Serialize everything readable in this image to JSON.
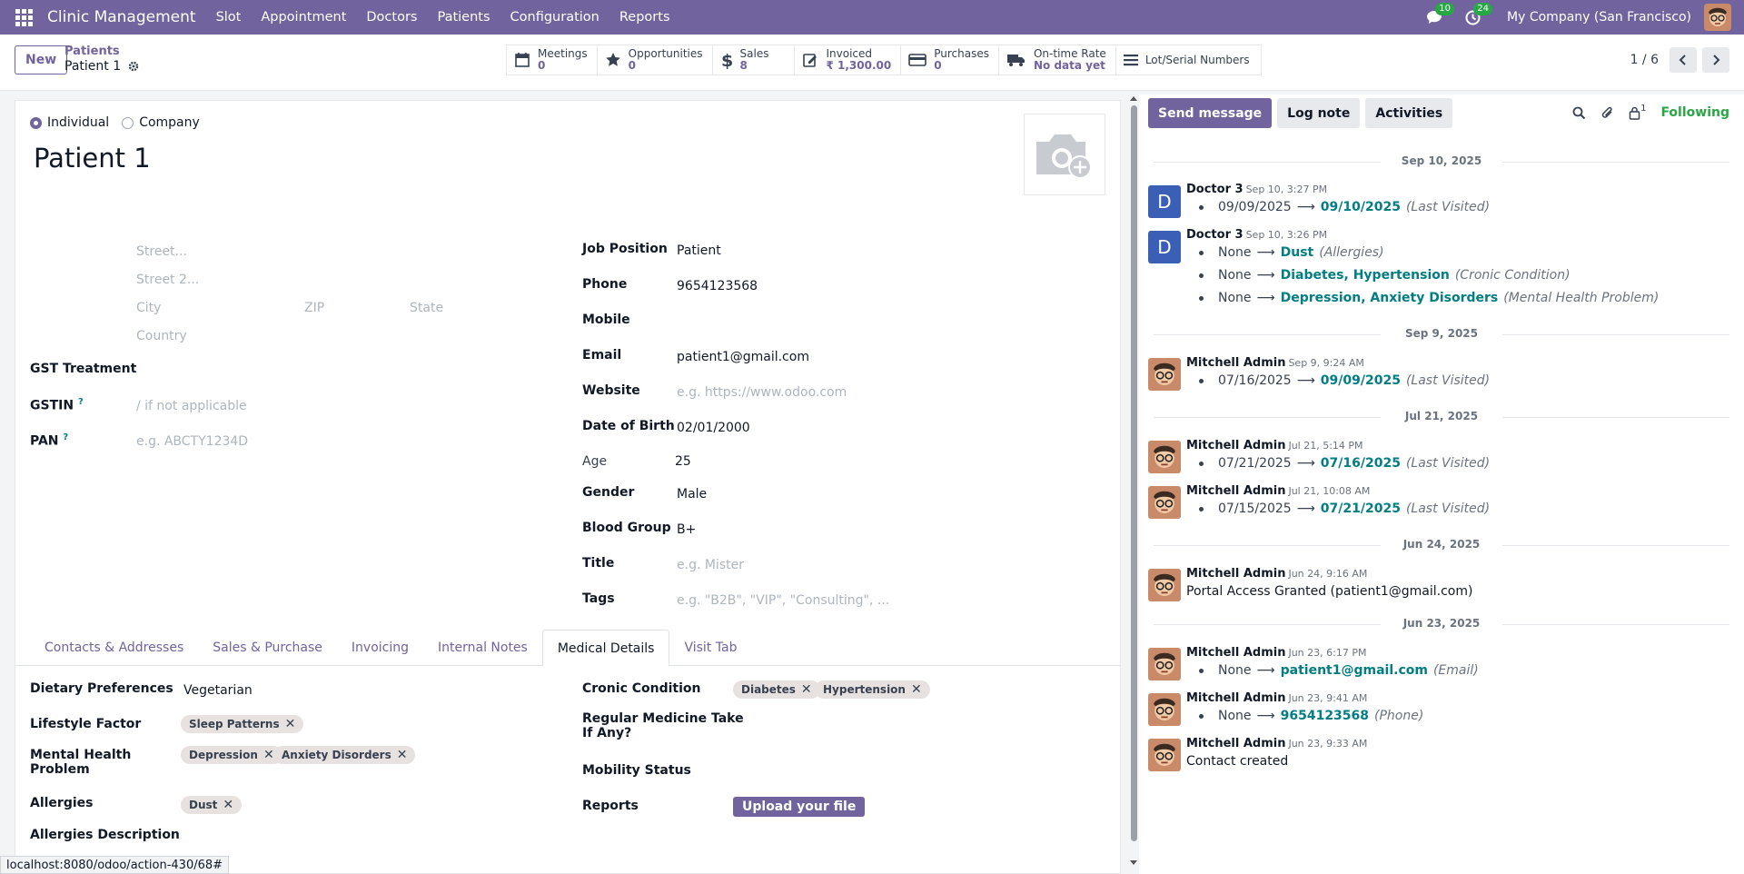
{
  "navbar": {
    "app_title": "Clinic Management",
    "menus": [
      "Slot",
      "Appointment",
      "Doctors",
      "Patients",
      "Configuration",
      "Reports"
    ],
    "messages_count": "10",
    "activities_count": "24",
    "company": "My Company (San Francisco)"
  },
  "control": {
    "new_label": "New",
    "breadcrumb_parent": "Patients",
    "breadcrumb_current": "Patient 1",
    "smart_buttons": [
      {
        "label": "Meetings",
        "value": "0",
        "icon": "calendar-icon"
      },
      {
        "label": "Opportunities",
        "value": "0",
        "icon": "star-icon"
      },
      {
        "label": "Sales",
        "value": "8",
        "icon": "dollar-icon"
      },
      {
        "label": "Invoiced",
        "value": "₹ 1,300.00",
        "icon": "pencil-square-icon"
      },
      {
        "label": "Purchases",
        "value": "0",
        "icon": "credit-card-icon"
      },
      {
        "label": "On-time Rate",
        "value": "No data yet",
        "icon": "truck-icon"
      },
      {
        "label": "Lot/Serial Numbers",
        "value": "",
        "icon": "bars-icon"
      }
    ],
    "pager": "1 / 6"
  },
  "form": {
    "type_individual": "Individual",
    "type_company": "Company",
    "name": "Patient 1",
    "address": {
      "street_ph": "Street...",
      "street2_ph": "Street 2...",
      "city_ph": "City",
      "zip_ph": "ZIP",
      "state_ph": "State",
      "country_ph": "Country"
    },
    "gst_treatment_label": "GST Treatment",
    "gstin_label": "GSTIN",
    "gstin_ph": "/ if not applicable",
    "pan_label": "PAN",
    "pan_ph": "e.g. ABCTY1234D",
    "help_mark": "?",
    "job_position_label": "Job Position",
    "job_position": "Patient",
    "phone_label": "Phone",
    "phone": "9654123568",
    "mobile_label": "Mobile",
    "email_label": "Email",
    "email": "patient1@gmail.com",
    "website_label": "Website",
    "website_ph": "e.g. https://www.odoo.com",
    "dob_label": "Date of Birth",
    "dob": "02/01/2000",
    "age_label": "Age",
    "age": "25",
    "gender_label": "Gender",
    "gender": "Male",
    "blood_label": "Blood Group",
    "blood": "B+",
    "title_label": "Title",
    "title_ph": "e.g. Mister",
    "tags_label": "Tags",
    "tags_ph": "e.g. \"B2B\", \"VIP\", \"Consulting\", ..."
  },
  "tabs": [
    "Contacts & Addresses",
    "Sales & Purchase",
    "Invoicing",
    "Internal Notes",
    "Medical Details",
    "Visit Tab"
  ],
  "medical": {
    "dietary_label": "Dietary Preferences",
    "dietary": "Vegetarian",
    "lifestyle_label": "Lifestyle Factor",
    "lifestyle_tag": "Sleep Patterns",
    "mental_label_1": "Mental Health",
    "mental_label_2": "Problem",
    "mental_tags": [
      "Depression",
      "Anxiety Disorders"
    ],
    "allergies_label": "Allergies",
    "allergies_tag": "Dust",
    "allergies_desc_label": "Allergies Description",
    "cronic_label": "Cronic Condition",
    "cronic_tags": [
      "Diabetes",
      "Hypertension"
    ],
    "medicine_label_1": "Regular Medicine Take",
    "medicine_label_2": "If Any?",
    "mobility_label": "Mobility Status",
    "reports_label": "Reports",
    "upload_label": "Upload your file",
    "tag_remove": "✕"
  },
  "chatter": {
    "send_message": "Send message",
    "log_note": "Log note",
    "activities": "Activities",
    "followers_count": "1",
    "following": "Following",
    "arrow": "⟶",
    "dates": [
      "Sep 10, 2025",
      "Sep 9, 2025",
      "Jul 21, 2025",
      "Jun 24, 2025",
      "Jun 23, 2025"
    ],
    "messages": [
      {
        "author": "Doctor 3",
        "time": "Sep 10, 3:27 PM",
        "avatar": "D",
        "lines": [
          {
            "old": "09/09/2025",
            "new": "09/10/2025",
            "field": "(Last Visited)"
          }
        ]
      },
      {
        "author": "Doctor 3",
        "time": "Sep 10, 3:26 PM",
        "avatar": "D",
        "lines": [
          {
            "old": "None",
            "new": "Dust",
            "field": "(Allergies)"
          },
          {
            "old": "None",
            "new": "Diabetes, Hypertension",
            "field": "(Cronic Condition)"
          },
          {
            "old": "None",
            "new": "Depression, Anxiety Disorders",
            "field": "(Mental Health Problem)"
          }
        ]
      },
      {
        "author": "Mitchell Admin",
        "time": "Sep 9, 9:24 AM",
        "lines": [
          {
            "old": "07/16/2025",
            "new": "09/09/2025",
            "field": "(Last Visited)"
          }
        ]
      },
      {
        "author": "Mitchell Admin",
        "time": "Jul 21, 5:14 PM",
        "lines": [
          {
            "old": "07/21/2025",
            "new": "07/16/2025",
            "field": "(Last Visited)"
          }
        ]
      },
      {
        "author": "Mitchell Admin",
        "time": "Jul 21, 10:08 AM",
        "lines": [
          {
            "old": "07/15/2025",
            "new": "07/21/2025",
            "field": "(Last Visited)"
          }
        ]
      },
      {
        "author": "Mitchell Admin",
        "time": "Jun 24, 9:16 AM",
        "text": "Portal Access Granted (patient1@gmail.com)"
      },
      {
        "author": "Mitchell Admin",
        "time": "Jun 23, 6:17 PM",
        "lines": [
          {
            "old": "None",
            "new": "patient1@gmail.com",
            "field": "(Email)"
          }
        ]
      },
      {
        "author": "Mitchell Admin",
        "time": "Jun 23, 9:41 AM",
        "lines": [
          {
            "old": "None",
            "new": "9654123568",
            "field": "(Phone)"
          }
        ]
      },
      {
        "author": "Mitchell Admin",
        "time": "Jun 23, 9:33 AM",
        "text": "Contact created"
      }
    ]
  },
  "status_url": "localhost:8080/odoo/action-430/68#",
  "colors": {
    "brand": "#71639e",
    "link": "#017e84",
    "following": "#28a745"
  }
}
